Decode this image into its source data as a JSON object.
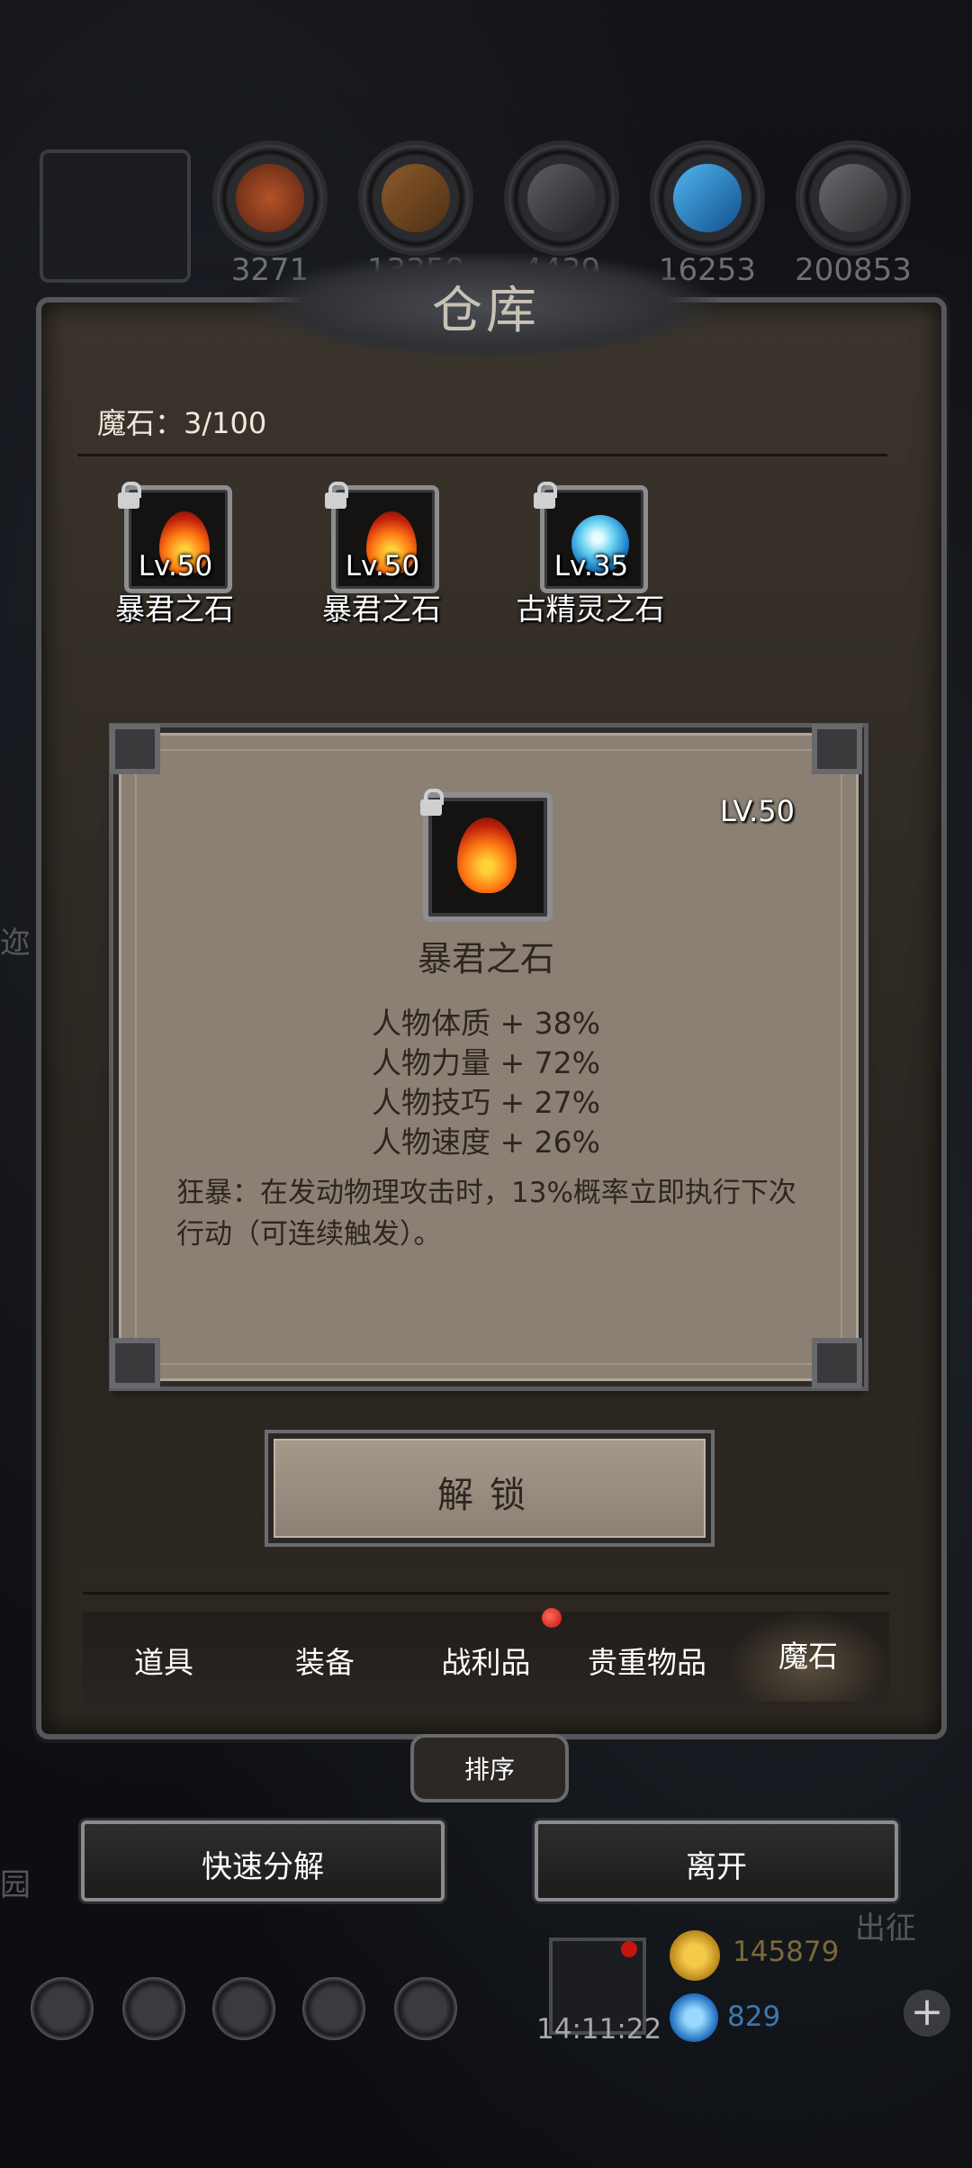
{
  "resources": {
    "values": [
      "3271",
      "13358",
      "4439",
      "16253",
      "200853"
    ]
  },
  "window": {
    "title": "仓库",
    "category_counter": "魔石：3/100"
  },
  "items": [
    {
      "name": "暴君之石",
      "level": "Lv.50",
      "icon": "fire-stone-icon"
    },
    {
      "name": "暴君之石",
      "level": "Lv.50",
      "icon": "fire-stone-icon"
    },
    {
      "name": "古精灵之石",
      "level": "Lv.35",
      "icon": "spirit-stone-icon"
    }
  ],
  "detail": {
    "level": "LV.50",
    "name": "暴君之石",
    "stats": [
      "人物体质 + 38%",
      "人物力量 + 72%",
      "人物技巧 + 27%",
      "人物速度 + 26%"
    ],
    "effect": "狂暴：在发动物理攻击时，13%概率立即执行下次行动（可连续触发）。",
    "unlock_label": "解锁"
  },
  "tabs": [
    {
      "label": "道具",
      "active": false
    },
    {
      "label": "装备",
      "active": false
    },
    {
      "label": "战利品",
      "active": false,
      "notification": true
    },
    {
      "label": "贵重物品",
      "active": false
    },
    {
      "label": "魔石",
      "active": true
    }
  ],
  "sort_label": "排序",
  "buttons": {
    "quick_decompose": "快速分解",
    "leave": "离开"
  },
  "hud": {
    "timer": "14:11:22",
    "gold": "145879",
    "gems": "829",
    "side_left_1": "迩",
    "side_left_2": "园",
    "side_right": "出征"
  },
  "colors": {
    "notification_dot": "#c4100c",
    "card_bg": "#8b8073"
  }
}
